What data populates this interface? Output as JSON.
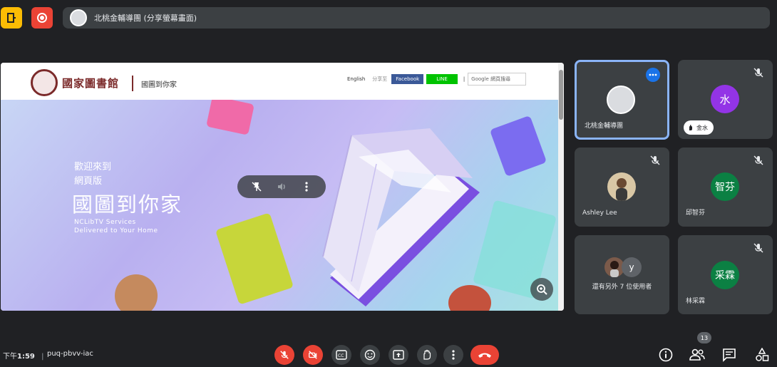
{
  "presentation": {
    "label": "北桃金輔導團 (分享螢幕畫面)"
  },
  "shared_site": {
    "logo_text": "國家圖書館",
    "logo_sub": "國圖到你家",
    "nav_english": "English",
    "nav_share": "分享至",
    "nav_facebook": "Facebook",
    "nav_line": "LINE",
    "nav_search": "Google 網頁搜尋",
    "banner_welcome_1": "歡迎來到",
    "banner_welcome_2": "網頁版",
    "banner_title": "國圖到你家",
    "banner_en_1": "NCLibTV Services",
    "banner_en_2": "Delivered to Your Home"
  },
  "tiles": [
    {
      "name": "北桃金輔導團",
      "active": true
    },
    {
      "name": "金水",
      "avatar_text": "水",
      "avatar_color": "#9334e6"
    },
    {
      "name": "Ashley Lee"
    },
    {
      "name": "邱智芬",
      "avatar_text": "智芬",
      "avatar_color": "#0b8043"
    },
    {
      "name": "還有另外 7 位使用者",
      "avatar_text": "y",
      "avatar_color": "#5f6368"
    },
    {
      "name": "林采霖",
      "avatar_text": "采霖",
      "avatar_color": "#0b8043"
    }
  ],
  "bottom": {
    "time_prefix": "下午",
    "time": "1:59",
    "separator": "|",
    "meeting_code": "puq-pbvv-iac",
    "participant_count": "13"
  },
  "colors": {
    "background": "#202124",
    "tile": "#3c4043",
    "danger": "#ea4335",
    "accent": "#8ab4f8"
  }
}
